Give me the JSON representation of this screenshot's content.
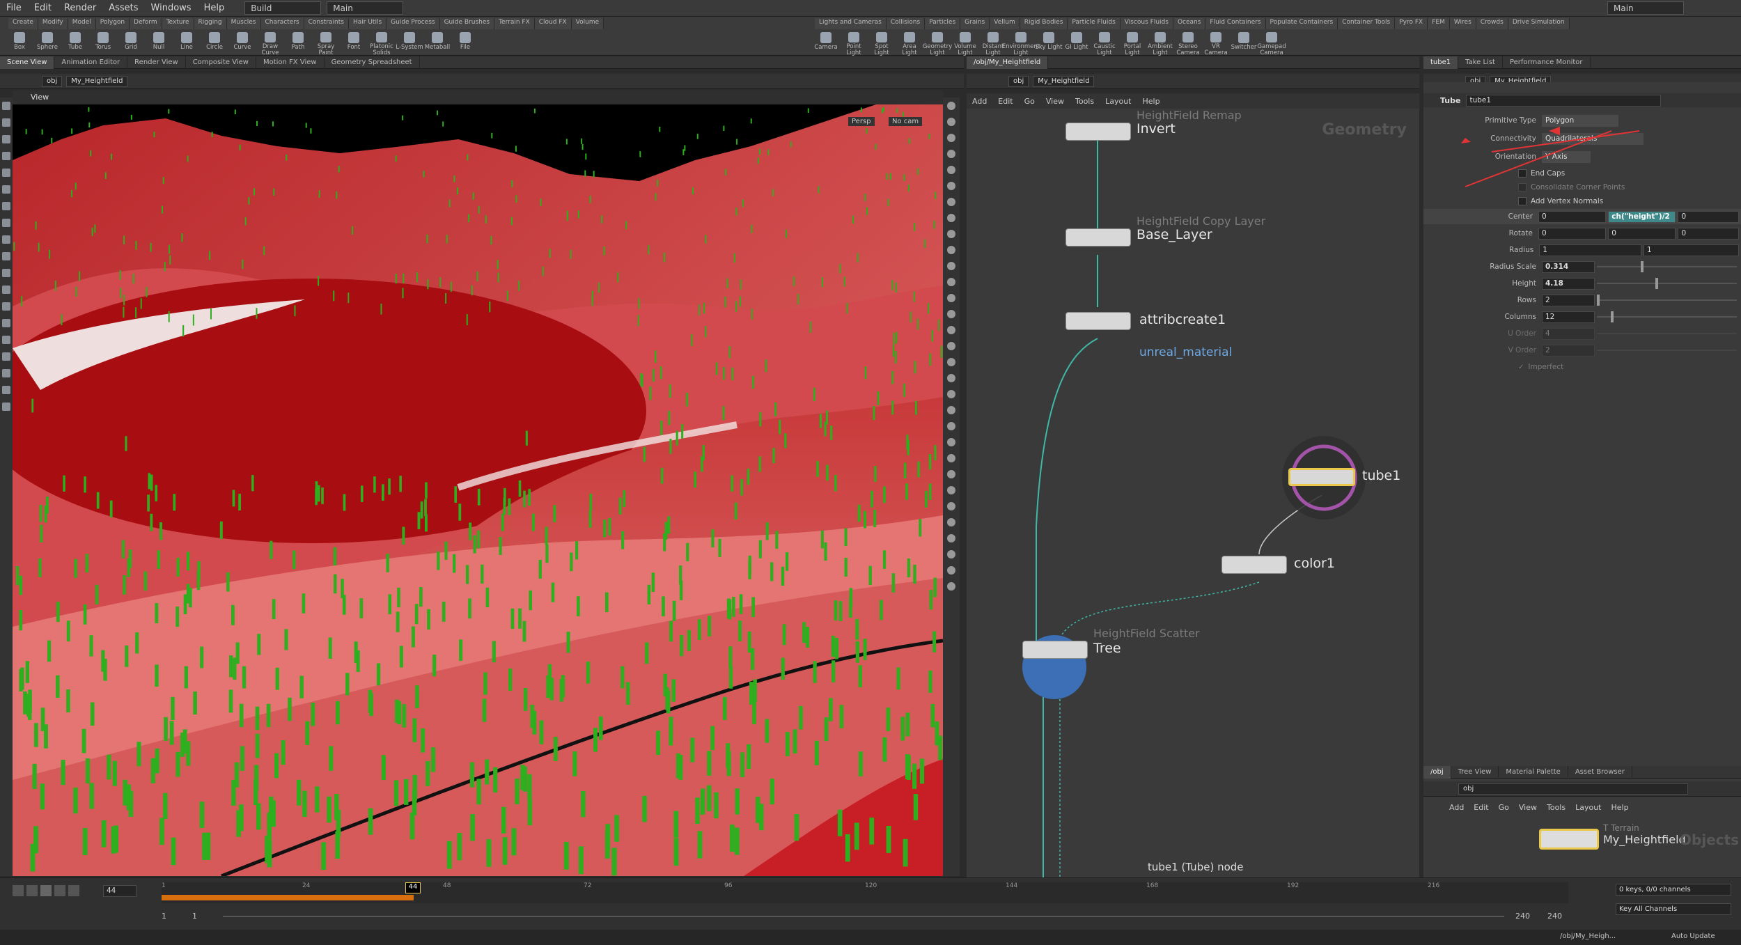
{
  "menu": [
    "File",
    "Edit",
    "Render",
    "Assets",
    "Windows",
    "Help"
  ],
  "desktop": "Build",
  "main_label": "Main",
  "right_main": "Main",
  "shelf_tabs_left": [
    "Create",
    "Modify",
    "Model",
    "Polygon",
    "Deform",
    "Texture",
    "Rigging",
    "Muscles",
    "Characters",
    "Constraints",
    "Hair Utils",
    "Guide Process",
    "Guide Brushes",
    "Terrain FX",
    "Cloud FX",
    "Volume"
  ],
  "shelf_tools_left": [
    "Box",
    "Sphere",
    "Tube",
    "Torus",
    "Grid",
    "Null",
    "Line",
    "Circle",
    "Curve",
    "Draw Curve",
    "Path",
    "Spray Paint",
    "Font",
    "Platonic Solids",
    "L-System",
    "Metaball",
    "File"
  ],
  "shelf_tabs_right": [
    "Lights and Cameras",
    "Collisions",
    "Particles",
    "Grains",
    "Vellum",
    "Rigid Bodies",
    "Particle Fluids",
    "Viscous Fluids",
    "Oceans",
    "Fluid Containers",
    "Populate Containers",
    "Container Tools",
    "Pyro FX",
    "FEM",
    "Wires",
    "Crowds",
    "Drive Simulation"
  ],
  "shelf_tools_right": [
    "Camera",
    "Point Light",
    "Spot Light",
    "Area Light",
    "Geometry Light",
    "Volume Light",
    "Distant Light",
    "Environment Light",
    "Sky Light",
    "GI Light",
    "Caustic Light",
    "Portal Light",
    "Ambient Light",
    "Stereo Camera",
    "VR Camera",
    "Switcher",
    "Gamepad Camera"
  ],
  "pane_tabs_left": [
    "Scene View",
    "Animation Editor",
    "Render View",
    "Composite View",
    "Motion FX View",
    "Geometry Spreadsheet"
  ],
  "pane_tabs_mid": [
    "/obj/My_Heightfield"
  ],
  "pane_tabs_right": [
    "tube1",
    "Take List",
    "Performance Monitor"
  ],
  "path_obj": "obj",
  "path_geo": "My_Heightfield",
  "viewport": {
    "label": "View",
    "persp": "Persp",
    "cam": "No cam"
  },
  "net_menu": [
    "Add",
    "Edit",
    "Go",
    "View",
    "Tools",
    "Layout",
    "Help"
  ],
  "net_context": "Geometry",
  "nodes": {
    "invert": {
      "type": "HeightField Remap",
      "name": "Invert"
    },
    "base": {
      "type": "HeightField Copy Layer",
      "name": "Base_Layer"
    },
    "attrib": {
      "name": "attribcreate1",
      "sub": "unreal_material"
    },
    "tube": {
      "name": "tube1"
    },
    "color": {
      "name": "color1"
    },
    "tree": {
      "type": "HeightField Scatter",
      "name": "Tree"
    }
  },
  "net_status": "tube1 (Tube) node",
  "params": {
    "header_type": "Tube",
    "header_name": "tube1",
    "rows": [
      {
        "label": "Primitive Type",
        "value": "Polygon"
      },
      {
        "label": "Connectivity",
        "value": "Quadrilaterals"
      },
      {
        "label": "Orientation",
        "value": "Y Axis"
      }
    ],
    "checks": [
      "End Caps",
      "Consolidate Corner Points",
      "Add Vertex Normals"
    ],
    "center": [
      "0",
      "ch(\"height\")/2",
      "0"
    ],
    "rotate": [
      "0",
      "0",
      "0"
    ],
    "radius": [
      "1",
      "1"
    ],
    "radius_scale": "0.314",
    "radius_scale_level": 0.314,
    "height": "4.18",
    "height_level": 0.418,
    "rows_val": "2",
    "columns": "12",
    "u_order": "4",
    "v_order": "2",
    "labels": [
      "Center",
      "Rotate",
      "Radius",
      "Radius Scale",
      "Height",
      "Rows",
      "Columns",
      "U Order",
      "V Order"
    ],
    "imperfect": "Imperfect"
  },
  "scene_tabs": [
    "/obj",
    "Tree View",
    "Material Palette",
    "Asset Browser"
  ],
  "scene_path": "obj",
  "scene_menu": [
    "Add",
    "Edit",
    "Go",
    "View",
    "Tools",
    "Layout",
    "Help"
  ],
  "scene_node": {
    "type": "T Terrain",
    "name": "My_Heightfield"
  },
  "scene_context": "Objects",
  "timeline": {
    "frame": "44",
    "ticks": [
      "1",
      "24",
      "48",
      "72",
      "96",
      "120",
      "144",
      "168",
      "192",
      "216"
    ],
    "start": "1",
    "start2": "1",
    "end": "240",
    "end2": "240",
    "keys": "0 keys, 0/0 channels",
    "keyall": "Key All Channels",
    "status_path": "/obj/My_Heigh...",
    "auto": "Auto Update"
  },
  "colors": {
    "terrain": "#c0262a",
    "grass": "#2fae1f",
    "accent": "#e9c84a"
  }
}
